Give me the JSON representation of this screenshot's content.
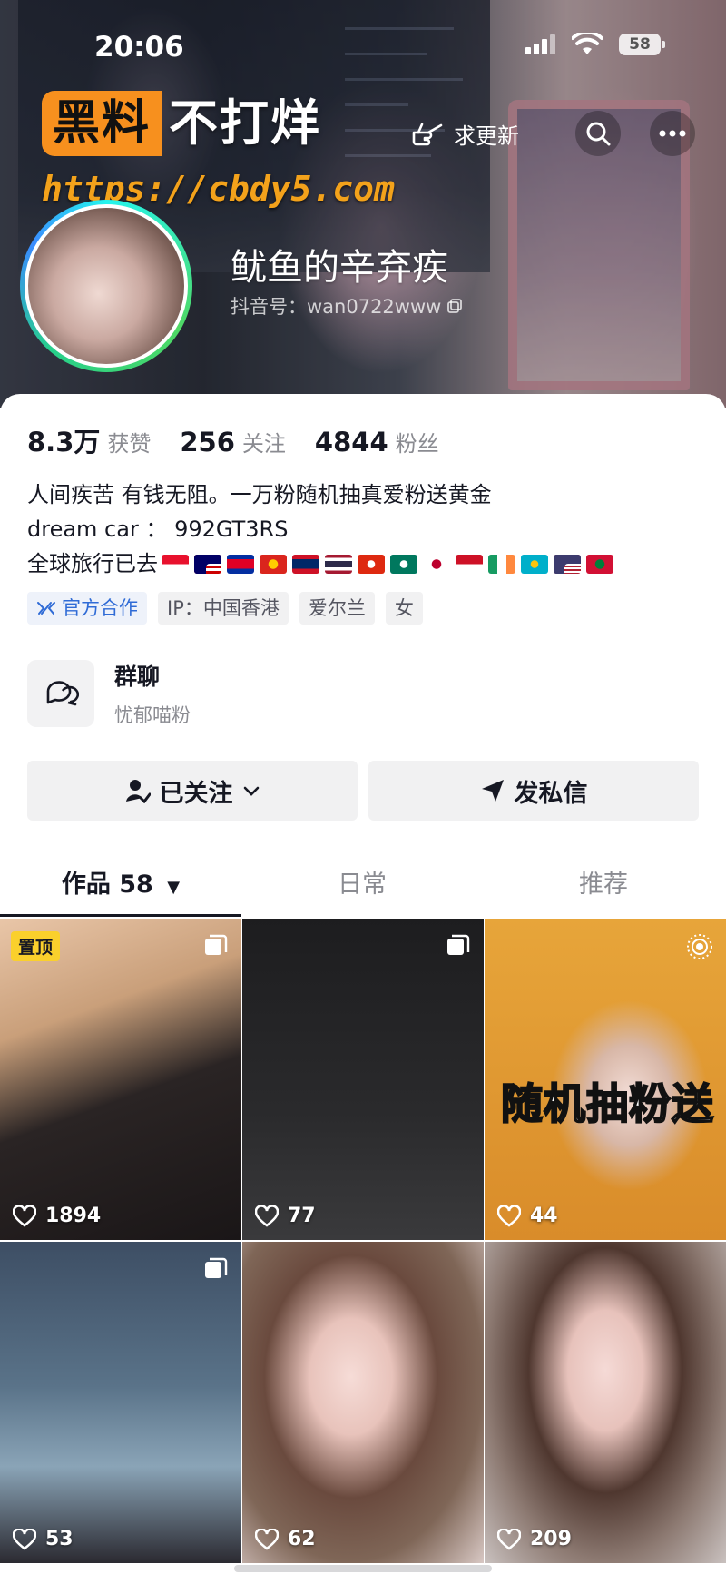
{
  "status_bar": {
    "time": "20:06",
    "battery": "58"
  },
  "watermark": {
    "box_text": "黑料",
    "text": "不打烊",
    "url": "https://cbdy5.com"
  },
  "header": {
    "update_label": "求更新"
  },
  "profile": {
    "name": "鱿鱼的辛弃疾",
    "douyin_id": "抖音号：wan0722www"
  },
  "stats": [
    {
      "num": "8.3万",
      "label": "获赞"
    },
    {
      "num": "256",
      "label": "关注"
    },
    {
      "num": "4844",
      "label": "粉丝"
    }
  ],
  "bio": {
    "line1": "人间疾苦 有钱无阻。一万粉随机抽真爱粉送黄金",
    "line2": "dream car ： 992GT3RS",
    "line3": "全球旅行已去"
  },
  "flags": [
    "singapore-flag",
    "malaysia-flag",
    "cambodia-flag",
    "vietnam-flag",
    "laos-flag",
    "thailand-flag",
    "hongkong-flag",
    "macau-flag",
    "japan-flag",
    "indonesia-flag",
    "ireland-flag",
    "kazakhstan-flag",
    "usa-flag",
    "maldives-flag"
  ],
  "tags": {
    "official": "官方合作",
    "ip": "IP：中国香港",
    "location": "爱尔兰",
    "gender": "女"
  },
  "group": {
    "title": "群聊",
    "subtitle": "忧郁喵粉"
  },
  "buttons": {
    "following": "已关注",
    "message": "发私信"
  },
  "tabs": {
    "works": "作品 58",
    "daily": "日常",
    "recommend": "推荐"
  },
  "grid": [
    {
      "likes": "1894",
      "pin": "置顶",
      "multi": true
    },
    {
      "likes": "77",
      "multi": true
    },
    {
      "likes": "44",
      "overlay": "随机抽粉送",
      "live": true
    },
    {
      "likes": "53",
      "multi": true
    },
    {
      "likes": "62"
    },
    {
      "likes": "209"
    }
  ],
  "colors": {
    "accent_blue": "#2f6bd6",
    "pin_yellow": "#fad02c",
    "watermark_orange": "#f7901e"
  }
}
